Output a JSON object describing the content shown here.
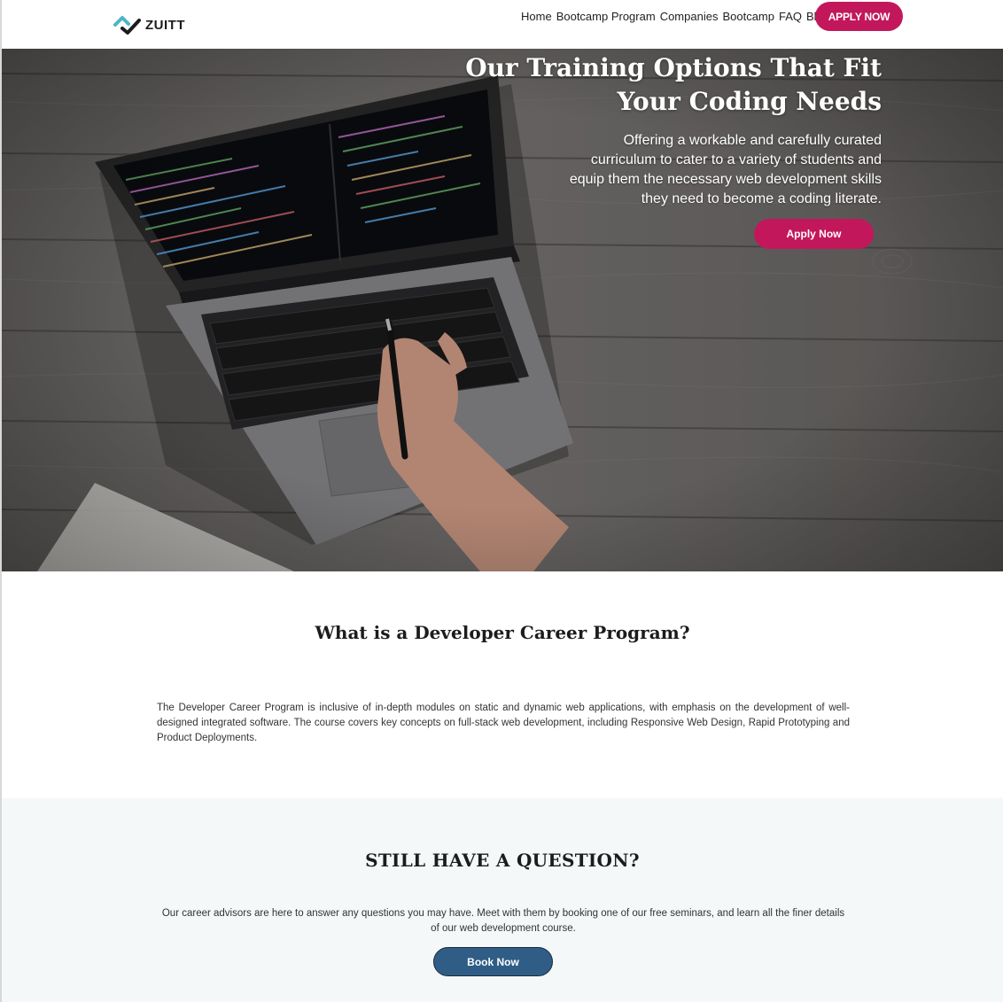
{
  "brand": {
    "name": "ZUITT"
  },
  "nav": {
    "links": [
      "Home",
      "Bootcamp Program",
      "Companies",
      "Bootcamp",
      "FAQ",
      "Blog"
    ],
    "apply_label": "APPLY NOW"
  },
  "hero": {
    "title_line1": "Our Training Options That Fit",
    "title_line2": "Your Coding Needs",
    "subtitle": "Offering a workable and carefully curated curriculum to cater to a variety of students and equip them the necessary web development skills they need to become a coding literate.",
    "apply_label": "Apply Now"
  },
  "about": {
    "title": "What is a Developer Career Program?",
    "body": "The Developer Career Program is inclusive of in-depth modules on static and dynamic web applications, with emphasis on the development of well-designed integrated software. The course covers key concepts on full-stack web development, including Responsive Web Design, Rapid Prototyping and Product Deployments."
  },
  "question": {
    "title": "STILL HAVE A QUESTION?",
    "body": "Our career advisors are here to answer any questions you may have. Meet with them by booking one of our free seminars, and learn all the finer details of our web development course.",
    "book_label": "Book Now"
  },
  "colors": {
    "accent": "#c2185b",
    "secondary_button": "#2f5d86",
    "logo_teal": "#4db6c4"
  }
}
